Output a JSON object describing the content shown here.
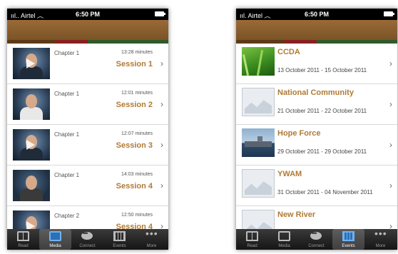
{
  "status": {
    "carrier": "Airtel",
    "time": "6:50 PM"
  },
  "colors": {
    "accent": "#b07a34",
    "banner": "#8a5e2f",
    "tabbar": "#222222"
  },
  "media": {
    "rows": [
      {
        "chapter": "Chapter 1",
        "minutes": "13:28 minutes",
        "session": "Session 1"
      },
      {
        "chapter": "Chapter 1",
        "minutes": "12:01 minutes",
        "session": "Session 2"
      },
      {
        "chapter": "Chapter 1",
        "minutes": "12:07 minutes",
        "session": "Session 3"
      },
      {
        "chapter": "Chapter 1",
        "minutes": "14:03 minutes",
        "session": "Session 4"
      },
      {
        "chapter": "Chapter 2",
        "minutes": "12:50 minutes",
        "session": "Session 4"
      }
    ]
  },
  "events": {
    "rows": [
      {
        "title": "CCDA",
        "dates": "13 October 2011 - 15 October 2011",
        "image": "grass-thumbnail"
      },
      {
        "title": "National Community",
        "dates": "21 October 2011 - 22 October 2011",
        "image": "placeholder-thumbnail"
      },
      {
        "title": "Hope Force",
        "dates": "29 October 2011 - 29 October 2011",
        "image": "ship-thumbnail"
      },
      {
        "title": "YWAM",
        "dates": "31 October 2011 - 04 November 2011",
        "image": "placeholder-thumbnail"
      },
      {
        "title": "New River",
        "dates": "",
        "image": "placeholder-thumbnail"
      }
    ]
  },
  "tabs": [
    {
      "label": "Read",
      "icon": "book-icon"
    },
    {
      "label": "Media",
      "icon": "tv-icon"
    },
    {
      "label": "Connect",
      "icon": "chat-bubble-icon"
    },
    {
      "label": "Events",
      "icon": "calendar-icon"
    },
    {
      "label": "More",
      "icon": "more-dots-icon"
    }
  ],
  "chevron": "›"
}
